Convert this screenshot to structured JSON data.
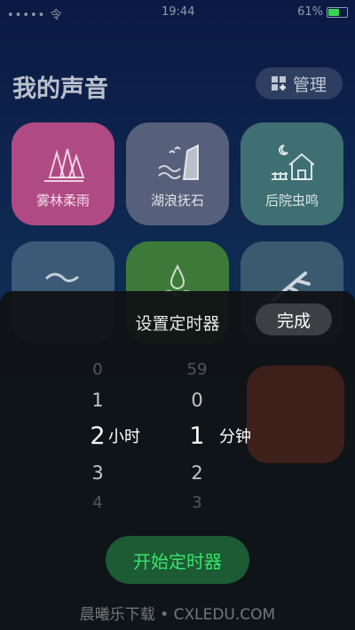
{
  "status_bar": {
    "carrier": "••••• 令",
    "time": "19:44",
    "battery_text": "61%",
    "battery_level": 0.61
  },
  "header": {
    "title": "我的声音",
    "manage_label": "管理"
  },
  "tiles": [
    {
      "label": "雾林柔雨",
      "color": "#b04a84",
      "icon": "forest-rain-icon"
    },
    {
      "label": "湖浪抚石",
      "color": "#56607a",
      "icon": "lake-wave-icon"
    },
    {
      "label": "后院虫鸣",
      "color": "#3e6f72",
      "icon": "backyard-house-icon"
    },
    {
      "label": "",
      "color": "#3a5a78",
      "icon": "river-icon"
    },
    {
      "label": "",
      "color": "#3d7a3a",
      "icon": "water-drop-icon"
    },
    {
      "label": "",
      "color": "#3a5a70",
      "icon": "branch-icon"
    }
  ],
  "timer": {
    "title": "设置定时器",
    "done_label": "完成",
    "hours": {
      "above2": "0",
      "above1": "1",
      "selected": "2",
      "below1": "3",
      "below2": "4",
      "unit": "小时"
    },
    "minutes": {
      "above2": "59",
      "above1": "0",
      "selected": "1",
      "below1": "2",
      "below2": "3",
      "unit": "分钟"
    },
    "start_label": "开始定时器"
  },
  "watermark": "晨曦乐下载 • CXLEDU.COM"
}
